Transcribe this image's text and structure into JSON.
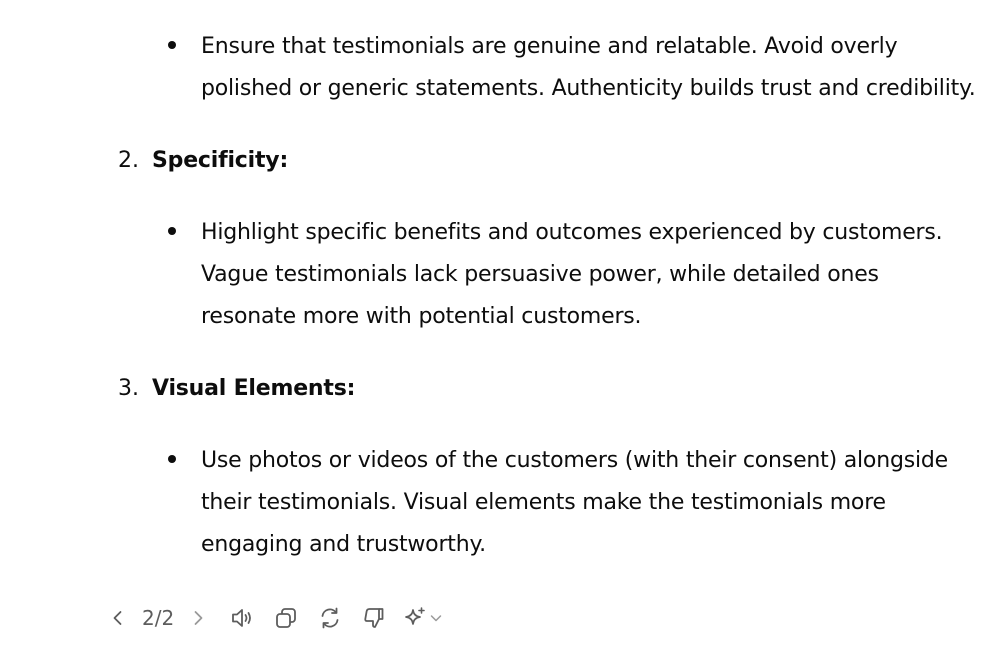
{
  "sections": {
    "intro_bullet": "Ensure that testimonials are genuine and relatable. Avoid overly polished or generic statements. Authenticity builds trust and credibility.",
    "item2": {
      "number": "2.",
      "title": "Specificity:",
      "bullet": "Highlight specific benefits and outcomes experienced by customers. Vague testimonials lack persuasive power, while detailed ones resonate more with potential customers."
    },
    "item3": {
      "number": "3.",
      "title": "Visual Elements:",
      "bullet": "Use photos or videos of the customers (with their consent) alongside their testimonials. Visual elements make the testimonials more engaging and trustworthy."
    }
  },
  "toolbar": {
    "pager": "2/2",
    "icons": [
      "chevron-left-icon",
      "chevron-right-icon",
      "speaker-icon",
      "copy-icon",
      "regenerate-icon",
      "thumbs-down-icon",
      "sparkle-icon",
      "chevron-down-icon"
    ],
    "icon_color": "#5d5d5d"
  }
}
